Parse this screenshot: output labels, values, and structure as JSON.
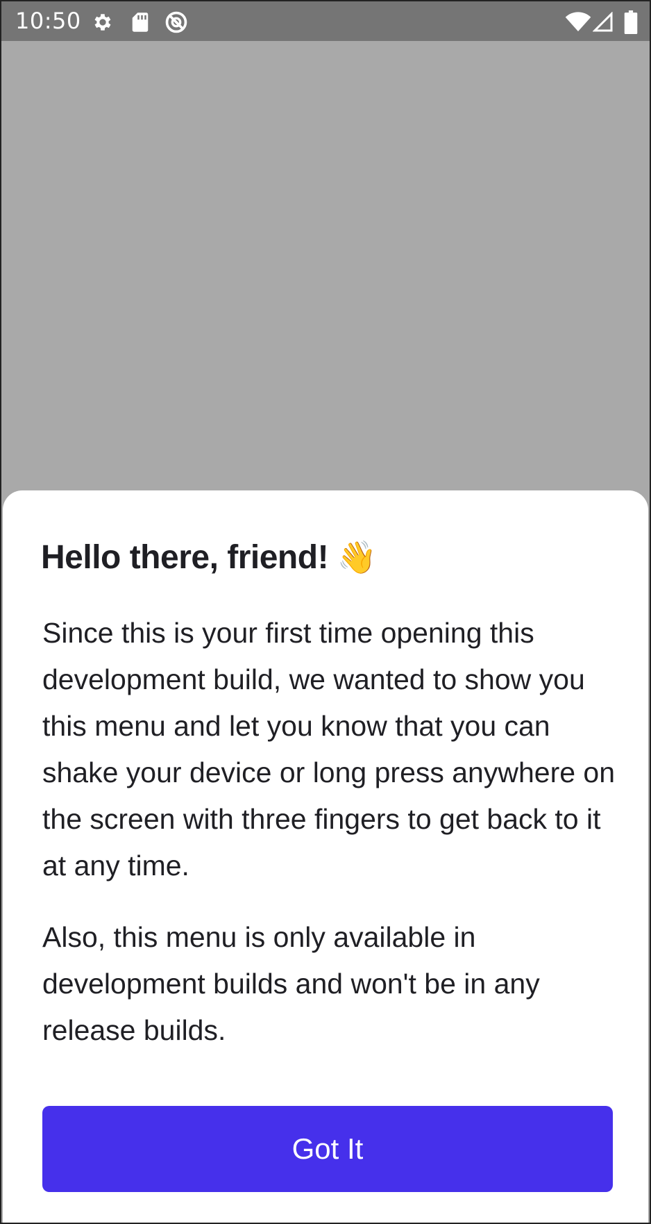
{
  "status_bar": {
    "time": "10:50",
    "icons_left": [
      "settings-icon",
      "sd-card-icon",
      "do-not-disturb-icon"
    ],
    "icons_right": [
      "wifi-icon",
      "cell-signal-icon",
      "battery-icon"
    ]
  },
  "sheet": {
    "title": "Hello there, friend!",
    "title_emoji": "👋",
    "paragraphs": [
      "Since this is your first time opening this development build, we wanted to show you this menu and let you know that you can shake your device or long press anywhere on the screen with three fingers to get back to it at any time.",
      "Also, this menu is only available in development builds and won't be in any release builds."
    ],
    "button_label": "Got It"
  },
  "colors": {
    "status_bar": "#757575",
    "overlay": "#a9a9a9",
    "sheet": "#ffffff",
    "text": "#1f1f24",
    "accent": "#4630eb"
  }
}
